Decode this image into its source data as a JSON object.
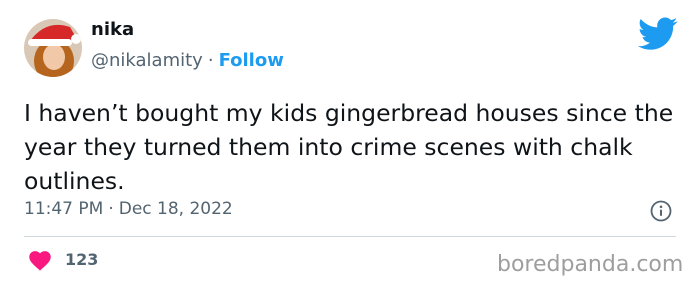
{
  "tweet": {
    "author_name": "nika",
    "handle": "@nikalamity",
    "separator": "·",
    "follow_label": "Follow",
    "text": "I haven’t bought my kids gingerbread houses since the year they turned them into crime scenes with chalk outlines.",
    "time": "11:47 PM",
    "date": "Dec 18, 2022",
    "like_count": "123"
  },
  "icons": {
    "avatar": "profile-photo-santa-hat",
    "logo": "twitter-bird-icon",
    "info": "info-icon",
    "like": "heart-icon"
  },
  "watermark": "boredpanda.com",
  "colors": {
    "twitter_blue": "#1d9bf0",
    "heart_pink": "#f91880",
    "secondary_text": "#536471",
    "divider": "#cfd9de"
  }
}
